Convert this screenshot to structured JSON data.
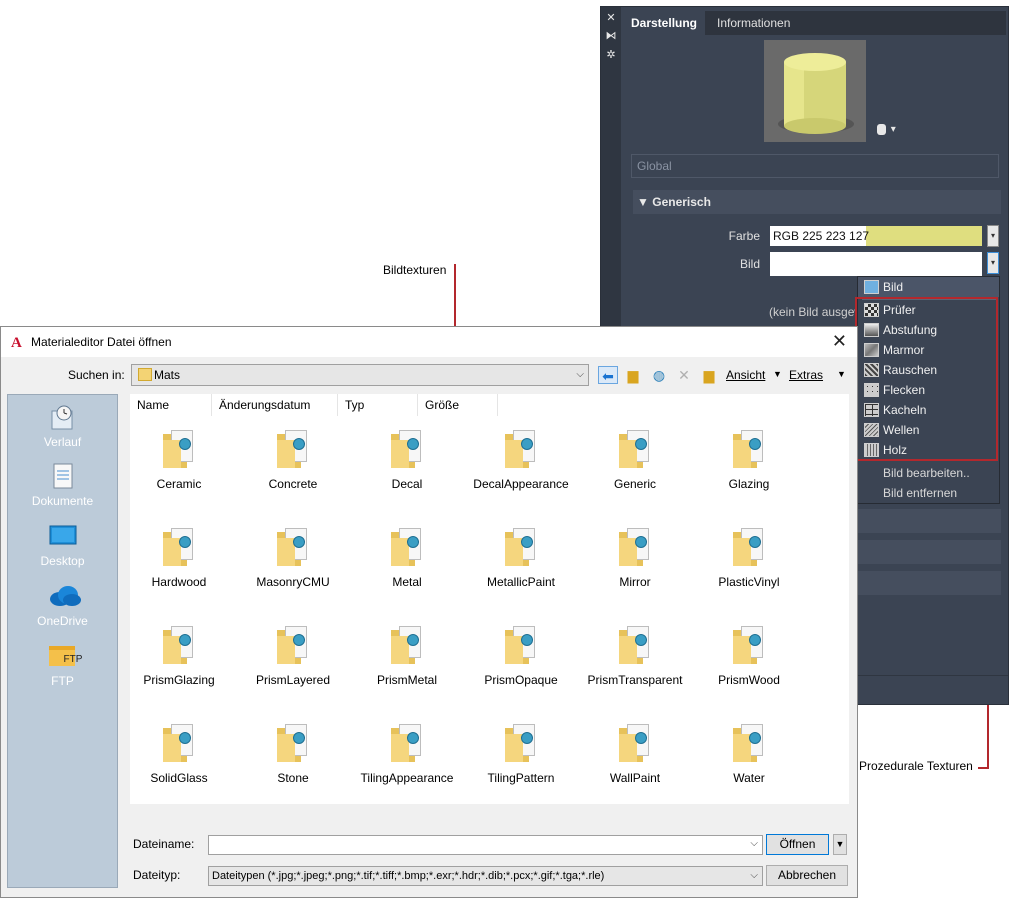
{
  "callouts": {
    "bildtexturen": "Bildtexturen",
    "prozedurale": "Prozedurale Texturen"
  },
  "panel": {
    "strip_close": "✕",
    "strip_pin": "⧑",
    "strip_settings": "✲",
    "tabs": [
      {
        "label": "Darstellung",
        "active": true
      },
      {
        "label": "Informationen",
        "active": false
      }
    ],
    "preview_options_icon": "cylinder-options-icon",
    "global_placeholder": "Global",
    "section_generic": "Generisch",
    "farbe_label": "Farbe",
    "farbe_value": "RGB 225 223 127",
    "farbe_color": "#dfde7f",
    "bild_label": "Bild",
    "kein_bild": "(kein Bild ausgew"
  },
  "menu": {
    "header": "Bild",
    "procedural": [
      "Prüfer",
      "Abstufung",
      "Marmor",
      "Rauschen",
      "Flecken",
      "Kacheln",
      "Wellen",
      "Holz"
    ],
    "edit": "Bild bearbeiten..",
    "remove": "Bild entfernen"
  },
  "dialog": {
    "title": "Materialeditor Datei öffnen",
    "app_icon": "A",
    "look_in_label": "Suchen in:",
    "look_in_value": "Mats",
    "toolbar": {
      "view_label": "Ansicht",
      "tools_label": "Extras"
    },
    "places": [
      "Verlauf",
      "Dokumente",
      "Desktop",
      "OneDrive",
      "FTP"
    ],
    "ftp_icon_text": "FTP",
    "columns": [
      "Name",
      "Änderungsdatum",
      "Typ",
      "Größe"
    ],
    "files": [
      "Ceramic",
      "Concrete",
      "Decal",
      "DecalAppearance",
      "Generic",
      "Glazing",
      "Hardwood",
      "MasonryCMU",
      "Metal",
      "MetallicPaint",
      "Mirror",
      "PlasticVinyl",
      "PrismGlazing",
      "PrismLayered",
      "PrismMetal",
      "PrismOpaque",
      "PrismTransparent",
      "PrismWood",
      "SolidGlass",
      "Stone",
      "TilingAppearance",
      "TilingPattern",
      "WallPaint",
      "Water"
    ],
    "filename_label": "Dateiname:",
    "filename_value": "",
    "filetype_label": "Dateityp:",
    "filetype_value": "Dateitypen  (*.jpg;*.jpeg;*.png;*.tif;*.tiff;*.bmp;*.exr;*.hdr;*.dib;*.pcx;*.gif;*.tga;*.rle)",
    "open_label": "Öffnen",
    "cancel_label": "Abbrechen"
  }
}
